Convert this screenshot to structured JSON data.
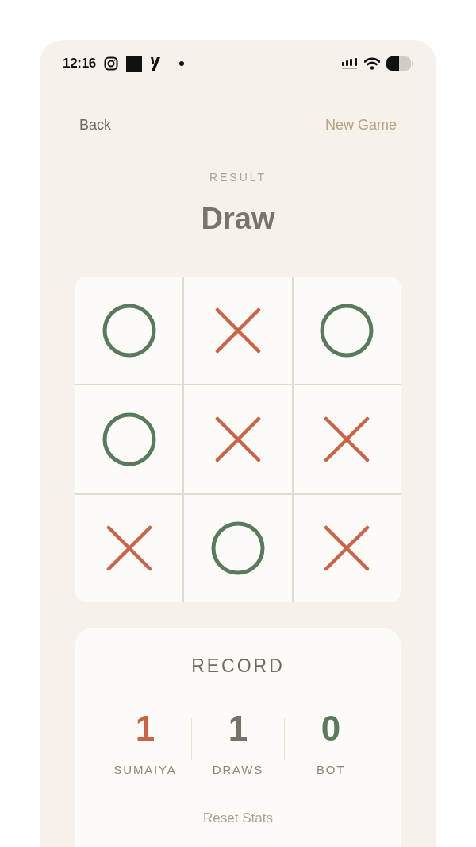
{
  "status_bar": {
    "time": "12:16"
  },
  "nav": {
    "back": "Back",
    "new_game": "New Game"
  },
  "result": {
    "label": "RESULT",
    "value": "Draw"
  },
  "board": {
    "cells": [
      {
        "kind": "o"
      },
      {
        "kind": "x"
      },
      {
        "kind": "o"
      },
      {
        "kind": "o"
      },
      {
        "kind": "x"
      },
      {
        "kind": "x"
      },
      {
        "kind": "x"
      },
      {
        "kind": "o"
      },
      {
        "kind": "x"
      }
    ]
  },
  "record": {
    "title": "RECORD",
    "stats": [
      {
        "value": "1",
        "label": "SUMAIYA",
        "color": "#c8644a"
      },
      {
        "value": "1",
        "label": "DRAWS",
        "color": "#77736a"
      },
      {
        "value": "0",
        "label": "BOT",
        "color": "#5a7a5e"
      }
    ],
    "reset": "Reset Stats"
  }
}
